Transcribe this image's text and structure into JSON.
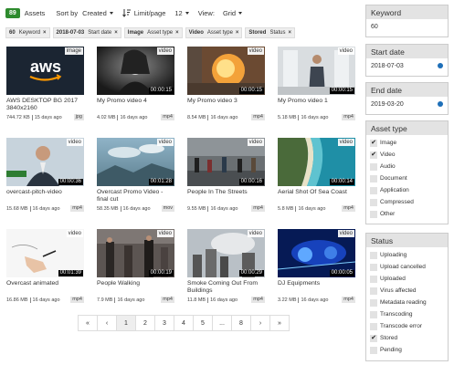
{
  "toolbar": {
    "count": "89",
    "assets_label": "Assets",
    "sort_by_label": "Sort by",
    "sort_value": "Created",
    "limit_label": "Limit/page",
    "limit_value": "12",
    "view_label": "View:",
    "view_value": "Grid"
  },
  "chips": [
    {
      "value": "60",
      "field": "Keyword"
    },
    {
      "value": "2018-07-03",
      "field": "Start date"
    },
    {
      "value": "Image",
      "field": "Asset type"
    },
    {
      "value": "Video",
      "field": "Asset type"
    },
    {
      "value": "Stored",
      "field": "Status"
    }
  ],
  "chip_close": "×",
  "assets": [
    {
      "title": "AWS DESKTOP BG 2017 3840x2160",
      "size": "744.72 KB",
      "age": "15 days ago",
      "ext": "jpg",
      "type": "image",
      "duration": ""
    },
    {
      "title": "My Promo video 4",
      "size": "4.02 MB",
      "age": "16 days ago",
      "ext": "mp4",
      "type": "video",
      "duration": "00:00:15"
    },
    {
      "title": "My Promo video 3",
      "size": "8.54 MB",
      "age": "16 days ago",
      "ext": "mp4",
      "type": "video",
      "duration": "00:00:15"
    },
    {
      "title": "My Promo video 1",
      "size": "5.18 MB",
      "age": "16 days ago",
      "ext": "mp4",
      "type": "video",
      "duration": "00:00:15"
    },
    {
      "title": "overcast-pitch-video",
      "size": "15.68 MB",
      "age": "16 days ago",
      "ext": "mp4",
      "type": "video",
      "duration": "00:00:36"
    },
    {
      "title": "Overcast Promo Video - final cut",
      "size": "58.35 MB",
      "age": "16 days ago",
      "ext": "mov",
      "type": "video",
      "duration": "00:01:28"
    },
    {
      "title": "People In The Streets",
      "size": "9.55 MB",
      "age": "16 days ago",
      "ext": "mp4",
      "type": "video",
      "duration": "00:00:16"
    },
    {
      "title": "Aerial Shot Of Sea Coast",
      "size": "5.8 MB",
      "age": "16 days ago",
      "ext": "mp4",
      "type": "video",
      "duration": "00:00:14"
    },
    {
      "title": "Overcast animated",
      "size": "16.86 MB",
      "age": "16 days ago",
      "ext": "mp4",
      "type": "video",
      "duration": "00:01:39"
    },
    {
      "title": "People Walking",
      "size": "7.9 MB",
      "age": "16 days ago",
      "ext": "mp4",
      "type": "video",
      "duration": "00:00:19"
    },
    {
      "title": "Smoke Coming Out From Buildings",
      "size": "11.8 MB",
      "age": "16 days ago",
      "ext": "mp4",
      "type": "video",
      "duration": "00:00:29"
    },
    {
      "title": "DJ Equipments",
      "size": "3.22 MB",
      "age": "16 days ago",
      "ext": "mp4",
      "type": "video",
      "duration": "00:00:05"
    }
  ],
  "pagination": [
    "«",
    "‹",
    "1",
    "2",
    "3",
    "4",
    "5",
    "...",
    "8",
    "›",
    "»"
  ],
  "pagination_active": "1",
  "sidebar": {
    "keyword": {
      "title": "Keyword",
      "value": "60"
    },
    "start_date": {
      "title": "Start date",
      "value": "2018-07-03"
    },
    "end_date": {
      "title": "End date",
      "value": "2019-03-20"
    },
    "asset_type": {
      "title": "Asset type",
      "options": [
        {
          "label": "Image",
          "checked": true
        },
        {
          "label": "Video",
          "checked": true
        },
        {
          "label": "Audio",
          "checked": false
        },
        {
          "label": "Document",
          "checked": false
        },
        {
          "label": "Application",
          "checked": false
        },
        {
          "label": "Compressed",
          "checked": false
        },
        {
          "label": "Other",
          "checked": false
        }
      ]
    },
    "status": {
      "title": "Status",
      "options": [
        {
          "label": "Uploading",
          "checked": false
        },
        {
          "label": "Upload cancelled",
          "checked": false
        },
        {
          "label": "Uploaded",
          "checked": false
        },
        {
          "label": "Virus affected",
          "checked": false
        },
        {
          "label": "Metadata reading",
          "checked": false
        },
        {
          "label": "Transcoding",
          "checked": false
        },
        {
          "label": "Transcode error",
          "checked": false
        },
        {
          "label": "Stored",
          "checked": true
        },
        {
          "label": "Pending",
          "checked": false
        }
      ]
    }
  },
  "colors": {
    "badge": "#2e8b2e",
    "date_icon": "#1e6fb8",
    "panel_head": "#e3e3e3"
  }
}
